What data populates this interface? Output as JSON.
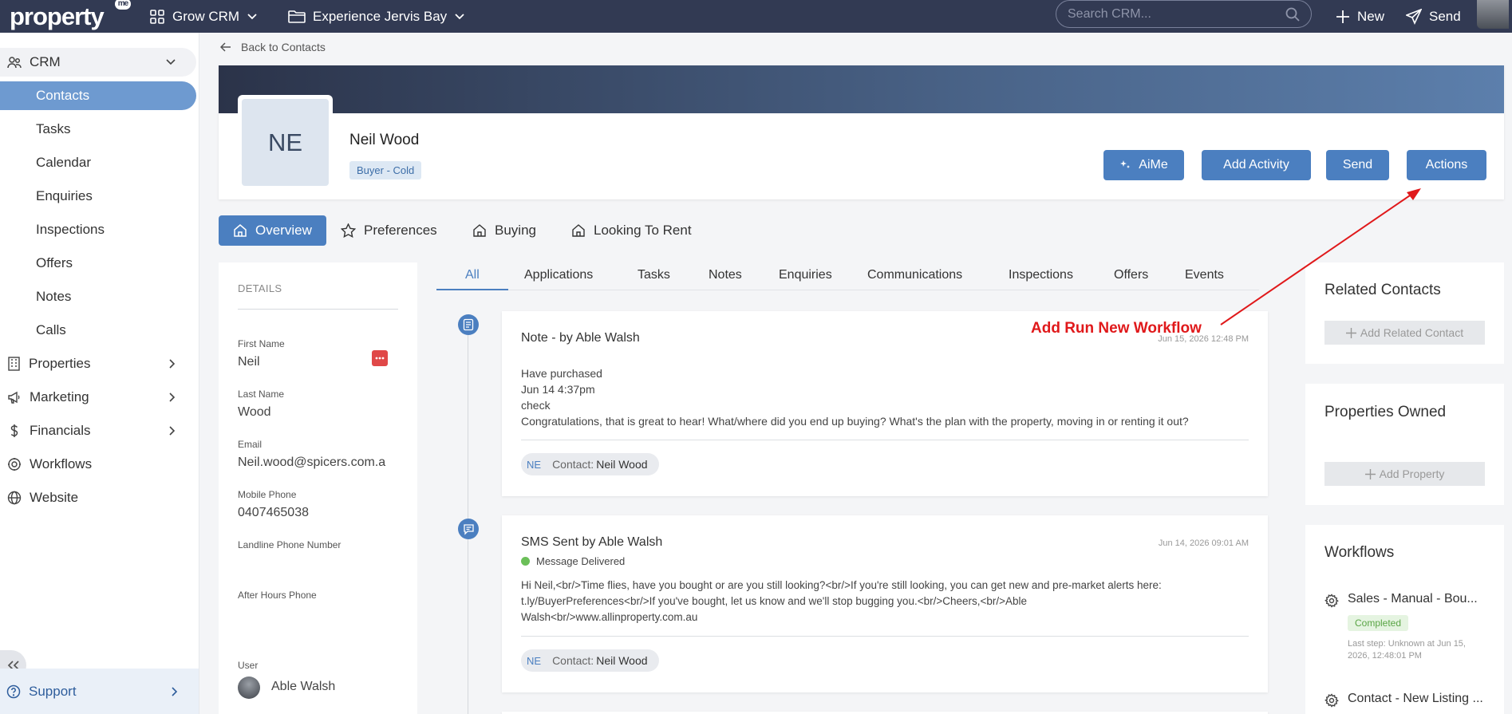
{
  "topbar": {
    "logo_text": "property",
    "logo_badge": "me",
    "workspace": "Grow CRM",
    "agency": "Experience Jervis Bay",
    "search_placeholder": "Search CRM...",
    "new_label": "New",
    "send_label": "Send"
  },
  "sidebar": {
    "crm_label": "CRM",
    "crm_items": [
      "Contacts",
      "Tasks",
      "Calendar",
      "Enquiries",
      "Inspections",
      "Offers",
      "Notes",
      "Calls"
    ],
    "properties_label": "Properties",
    "marketing_label": "Marketing",
    "financials_label": "Financials",
    "workflows_label": "Workflows",
    "website_label": "Website",
    "support_label": "Support"
  },
  "back_label": "Back to Contacts",
  "contact": {
    "initials": "NE",
    "name": "Neil Wood",
    "tag": "Buyer - Cold"
  },
  "header_buttons": {
    "aime": "AiMe",
    "add_activity": "Add Activity",
    "send": "Send",
    "actions": "Actions"
  },
  "section_tabs": [
    "Overview",
    "Preferences",
    "Buying",
    "Looking To Rent"
  ],
  "details": {
    "title": "DETAILS",
    "first_name_label": "First Name",
    "first_name": "Neil",
    "last_name_label": "Last Name",
    "last_name": "Wood",
    "email_label": "Email",
    "email": "Neil.wood@spicers.com.a",
    "mobile_label": "Mobile Phone",
    "mobile": "0407465038",
    "landline_label": "Landline Phone Number",
    "after_hours_label": "After Hours Phone",
    "user_label": "User",
    "user": "Able Walsh"
  },
  "activity_tabs": [
    "All",
    "Applications",
    "Tasks",
    "Notes",
    "Enquiries",
    "Communications",
    "Inspections",
    "Offers",
    "Events"
  ],
  "activities": [
    {
      "title": "Note - by Able Walsh",
      "time": "Jun 15, 2026 12:48 PM",
      "lines": [
        "Have purchased",
        "Jun 14 4:37pm",
        "check",
        "Congratulations, that is great to hear! What/where did you end up buying? What's the plan with the property, moving in or renting it out?"
      ],
      "chip_initials": "NE",
      "chip_prefix": "Contact:",
      "chip_name": "Neil Wood"
    },
    {
      "title": "SMS Sent by Able Walsh",
      "time": "Jun 14, 2026 09:01 AM",
      "status": "Message Delivered",
      "lines": [
        "Hi Neil,<br/>Time flies, have you bought or are you still looking?<br/>If you're still looking, you can get new and pre-market alerts here:",
        "t.ly/BuyerPreferences<br/>If you've bought, let us know and we'll stop bugging you.<br/>Cheers,<br/>Able",
        "Walsh<br/>www.allinproperty.com.au"
      ],
      "chip_initials": "NE",
      "chip_prefix": "Contact:",
      "chip_name": "Neil Wood"
    }
  ],
  "related_contacts": {
    "title": "Related Contacts",
    "add_label": "Add Related Contact"
  },
  "properties_owned": {
    "title": "Properties Owned",
    "add_label": "Add Property"
  },
  "workflows": {
    "title": "Workflows",
    "items": [
      {
        "name": "Sales - Manual - Bou...",
        "status": "Completed",
        "meta_line1": "Last step: Unknown at Jun 15,",
        "meta_line2": "2026, 12:48:01 PM"
      },
      {
        "name": "Contact - New Listing ..."
      }
    ]
  },
  "annotation": {
    "text": "Add Run New Workflow",
    "color": "#e0191b"
  },
  "colors": {
    "topbar": "#323a53",
    "accent": "#4b7fc0",
    "sidebar_active": "#6e9ad0"
  }
}
